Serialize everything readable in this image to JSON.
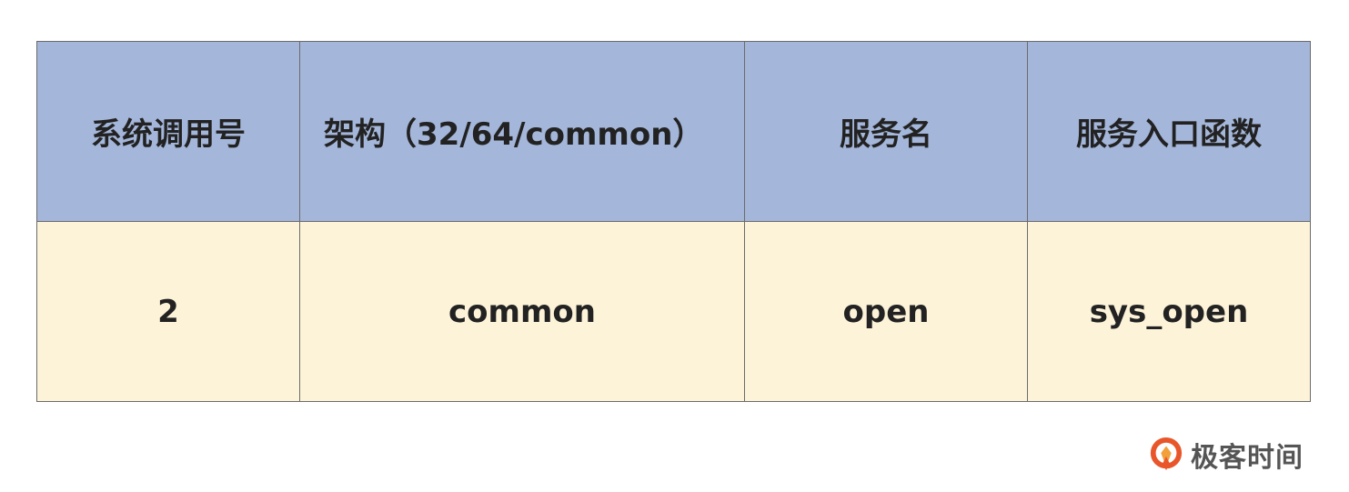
{
  "table": {
    "headers": [
      "系统调用号",
      "架构（32/64/common）",
      "服务名",
      "服务入口函数"
    ],
    "rows": [
      [
        "2",
        "common",
        "open",
        "sys_open"
      ]
    ]
  },
  "brand": {
    "name": "极客时间",
    "accent_color": "#e8562a"
  },
  "colors": {
    "header_bg": "#a4b6d9",
    "row_bg": "#fdf3d9"
  }
}
